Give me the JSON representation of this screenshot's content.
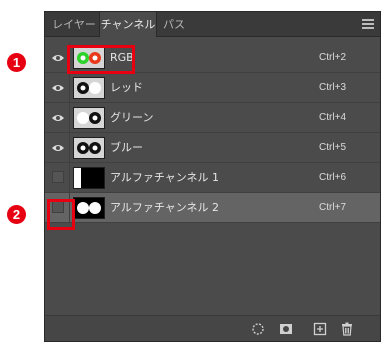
{
  "tabs": [
    {
      "label": "レイヤー",
      "active": false
    },
    {
      "label": "チャンネル",
      "active": true
    },
    {
      "label": "パス",
      "active": false
    }
  ],
  "panel_menu_icon": "hamburger-menu-icon",
  "channels": [
    {
      "name": "RGB",
      "shortcut": "Ctrl+2",
      "visible": true,
      "selected": false,
      "thumbnail": "rgb"
    },
    {
      "name": "レッド",
      "shortcut": "Ctrl+3",
      "visible": true,
      "selected": false,
      "thumbnail": "red"
    },
    {
      "name": "グリーン",
      "shortcut": "Ctrl+4",
      "visible": true,
      "selected": false,
      "thumbnail": "green"
    },
    {
      "name": "ブルー",
      "shortcut": "Ctrl+5",
      "visible": true,
      "selected": false,
      "thumbnail": "blue"
    },
    {
      "name": "アルファチャンネル 1",
      "shortcut": "Ctrl+6",
      "visible": false,
      "selected": false,
      "thumbnail": "alpha1"
    },
    {
      "name": "アルファチャンネル 2",
      "shortcut": "Ctrl+7",
      "visible": false,
      "selected": true,
      "thumbnail": "alpha2"
    }
  ],
  "bottom_icons": [
    "load-selection-icon",
    "save-selection-icon",
    "new-channel-icon",
    "trash-icon"
  ],
  "callouts": [
    {
      "label": "1",
      "color": "#e60012"
    },
    {
      "label": "2",
      "color": "#e60012"
    }
  ]
}
